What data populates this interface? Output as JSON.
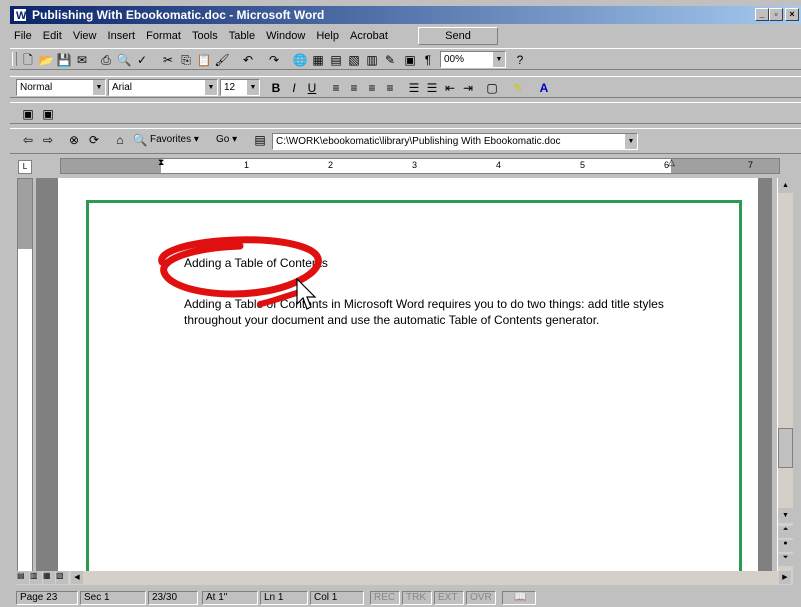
{
  "window": {
    "title": "Publishing With Ebookomatic.doc - Microsoft Word"
  },
  "menu": {
    "items": [
      "File",
      "Edit",
      "View",
      "Insert",
      "Format",
      "Tools",
      "Table",
      "Window",
      "Help",
      "Acrobat"
    ],
    "send_label": "Send"
  },
  "formatting": {
    "style": "Normal",
    "font": "Arial",
    "size": "12",
    "zoom": "00%"
  },
  "web": {
    "favorites_label": "Favorites",
    "go_label": "Go",
    "address": "C:\\WORK\\ebookomatic\\library\\Publishing With Ebookomatic.doc"
  },
  "ruler": {
    "numbers": [
      "1",
      "2",
      "3",
      "4",
      "5",
      "6",
      "7"
    ]
  },
  "document": {
    "heading": "Adding a Table of Contents",
    "body": "Adding a Table of Contents in Microsoft Word requires you to do two things: add title styles throughout your document and use the automatic Table of Contents generator."
  },
  "status": {
    "page": "Page 23",
    "sec": "Sec 1",
    "pages": "23/30",
    "at": "At 1\"",
    "ln": "Ln 1",
    "col": "Col 1",
    "rec": "REC",
    "trk": "TRK",
    "ext": "EXT",
    "ovr": "OVR"
  },
  "colors": {
    "page_border": "#2d9a52",
    "annotation": "#e01010",
    "title_bar": "#0a246a"
  }
}
